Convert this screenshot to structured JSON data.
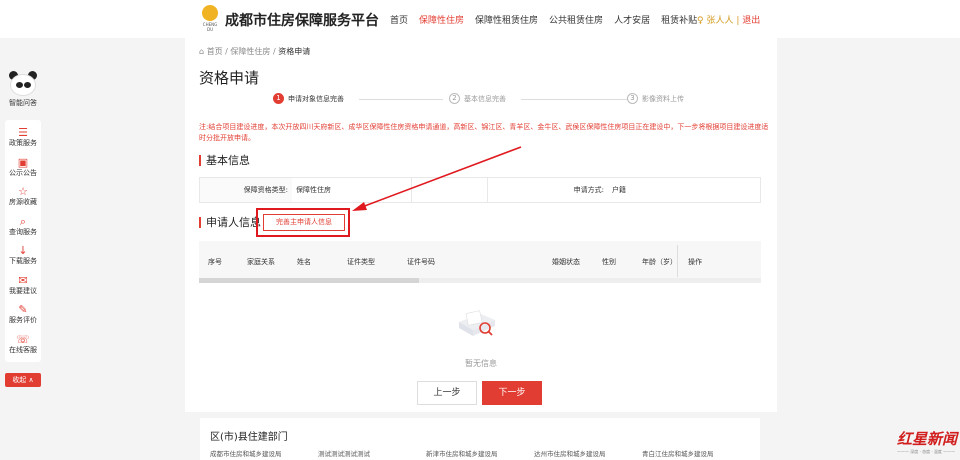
{
  "header": {
    "logo_text": "CHENG DU",
    "title": "成都市住房保障服务平台",
    "nav": [
      {
        "label": "首页",
        "active": false
      },
      {
        "label": "保障性住房",
        "active": true
      },
      {
        "label": "保障性租赁住房",
        "active": false
      },
      {
        "label": "公共租赁住房",
        "active": false
      },
      {
        "label": "人才安居",
        "active": false
      },
      {
        "label": "租赁补贴",
        "active": false
      }
    ],
    "user_name": "张人人",
    "logout": "退出"
  },
  "assistant": {
    "label": "智能问答"
  },
  "sidebar": {
    "items": [
      {
        "icon": "document-icon",
        "glyph": "☰",
        "label": "政策服务"
      },
      {
        "icon": "announcement-icon",
        "glyph": "▣",
        "label": "公示公告"
      },
      {
        "icon": "star-icon",
        "glyph": "☆",
        "label": "房源收藏"
      },
      {
        "icon": "query-icon",
        "glyph": "⌕",
        "label": "查询服务"
      },
      {
        "icon": "download-icon",
        "glyph": "↓",
        "label": "下载服务"
      },
      {
        "icon": "mail-icon",
        "glyph": "✉",
        "label": "我要建议"
      },
      {
        "icon": "evaluate-icon",
        "glyph": "✎",
        "label": "服务评价"
      },
      {
        "icon": "headset-icon",
        "glyph": "☏",
        "label": "在线客服"
      }
    ],
    "collapse": "收起 ∧"
  },
  "breadcrumb": {
    "home": "首页",
    "sep": "/",
    "level1": "保障性住房",
    "current": "资格申请"
  },
  "page_title": "资格申请",
  "steps": [
    {
      "num": "1",
      "label": "申请对象信息完善",
      "active": true
    },
    {
      "num": "2",
      "label": "基本信息完善",
      "active": false
    },
    {
      "num": "3",
      "label": "影像资料上传",
      "active": false
    }
  ],
  "notice": "注:结合项目建设进度，本次开放四川天府新区、成华区保障性住房资格申请通道，高新区、锦江区、青羊区、金牛区、武侯区保障性住房项目正在建设中，下一步将根据项目建设进度适时分批开放申请。",
  "basic_info": {
    "title": "基本信息",
    "type_label": "保障资格类型:",
    "type_value": "保障性住房",
    "method_label": "申请方式:",
    "method_value": "户籍"
  },
  "applicant": {
    "title": "申请人信息",
    "complete_button": "完善主申请人信息",
    "columns": [
      "序号",
      "家庭关系",
      "姓名",
      "证件类型",
      "证件号码",
      "婚姻状态",
      "性别",
      "年龄（岁）",
      "操作"
    ],
    "empty": "暂无信息"
  },
  "buttons": {
    "prev": "上一步",
    "next": "下一步"
  },
  "footer": {
    "title": "区(市)县住建部门",
    "links": [
      "成都市住房和城乡建设局",
      "测试测试测试测试",
      "新津市住房和城乡建设局",
      "达州市住房和城乡建设局",
      "青白江住房和城乡建设局"
    ]
  },
  "watermark": {
    "text": "红星新闻",
    "sub": "——— 深度 · 态度 · 温度 ———"
  },
  "colors": {
    "accent": "#e23d32",
    "highlight": "#e0191e"
  }
}
